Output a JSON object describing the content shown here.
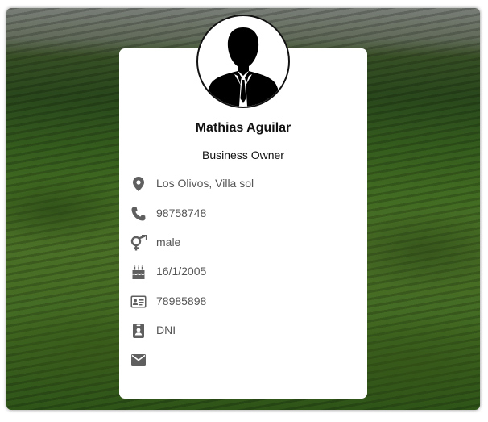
{
  "profile": {
    "name": "Mathias Aguilar",
    "job": "Business Owner",
    "avatar_icon": "user-silhouette-icon"
  },
  "details": {
    "address": {
      "icon": "map-marker-icon",
      "value": "Los Olivos, Villa sol"
    },
    "phone": {
      "icon": "phone-icon",
      "value": "98758748"
    },
    "gender": {
      "icon": "gender-icon",
      "value": "male"
    },
    "birthday": {
      "icon": "birthday-cake-icon",
      "value": "16/1/2005"
    },
    "document_number": {
      "icon": "id-card-icon",
      "value": "78985898"
    },
    "document_type": {
      "icon": "id-badge-icon",
      "value": "DNI"
    },
    "email": {
      "icon": "envelope-icon",
      "value": ""
    }
  },
  "colors": {
    "icon": "#5f5f5f",
    "text": "#555555",
    "title": "#111111",
    "card": "#ffffff"
  }
}
